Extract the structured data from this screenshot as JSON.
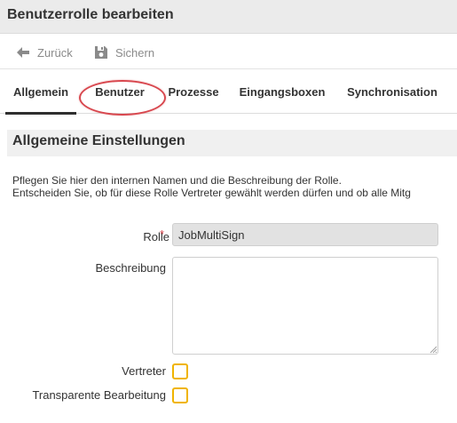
{
  "window": {
    "title": "Benutzerrolle bearbeiten"
  },
  "toolbar": {
    "back_label": "Zurück",
    "back_icon": "arrow-left-icon",
    "save_label": "Sichern",
    "save_icon": "floppy-disk-icon"
  },
  "tabs": [
    {
      "label": "Allgemein",
      "active": true
    },
    {
      "label": "Benutzer",
      "active": false,
      "highlighted": true
    },
    {
      "label": "Prozesse",
      "active": false
    },
    {
      "label": "Eingangsboxen",
      "active": false
    },
    {
      "label": "Synchronisation",
      "active": false
    }
  ],
  "section": {
    "title": "Allgemeine Einstellungen",
    "description_line1": "Pflegen Sie hier den internen Namen und die Beschreibung der Rolle.",
    "description_line2": "Entscheiden Sie, ob für diese Rolle Vertreter gewählt werden dürfen und ob alle Mitg"
  },
  "form": {
    "rolle_label": "Rolle",
    "rolle_required_mark": "*",
    "rolle_value": "JobMultiSign",
    "beschreibung_label": "Beschreibung",
    "beschreibung_value": "",
    "vertreter_label": "Vertreter",
    "vertreter_checked": false,
    "transparente_label": "Transparente Bearbeitung",
    "transparente_checked": false
  },
  "colors": {
    "highlight_ring": "#d8474e",
    "required_mark": "#d8474e",
    "checkbox_border": "#f0b400",
    "title_bar_bg": "#ebebeb",
    "active_tab_underline": "#2f2f2f"
  }
}
